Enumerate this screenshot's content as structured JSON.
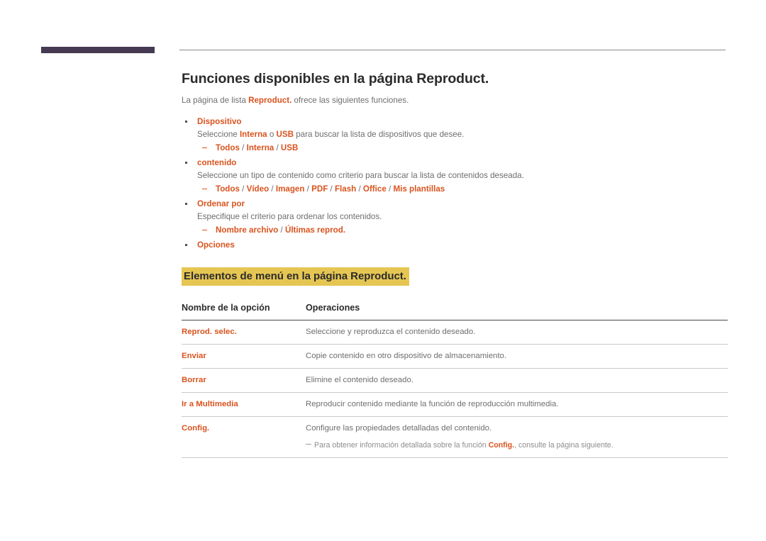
{
  "page": {
    "deco_color": "#453a52",
    "accent_color": "#d9531e",
    "highlight_color": "#e6c653",
    "body_color": "#6e6e6e"
  },
  "title": "Funciones disponibles en la página Reproduct.",
  "intro": {
    "before": "La página de lista ",
    "accent": "Reproduct.",
    "after": " ofrece las siguientes funciones."
  },
  "bullets": [
    {
      "label": "Dispositivo",
      "desc_before": "Seleccione ",
      "desc_accent1": "Interna",
      "desc_mid": " o ",
      "desc_accent2": "USB",
      "desc_after": " para buscar la lista de dispositivos que desee.",
      "options": "Todos / Interna / USB"
    },
    {
      "label": "contenido",
      "desc": "Seleccione un tipo de contenido como criterio para buscar la lista de contenidos deseada.",
      "options": "Todos / Vídeo / Imagen / PDF / Flash / Office / Mis plantillas"
    },
    {
      "label": "Ordenar por",
      "desc": "Especifique el criterio para ordenar los contenidos.",
      "options": "Nombre archivo / Últimas reprod."
    },
    {
      "label": "Opciones"
    }
  ],
  "sub_heading": "Elementos de menú en la página Reproduct.",
  "table": {
    "headers": [
      "Nombre de la opción",
      "Operaciones"
    ],
    "rows": [
      {
        "name": "Reprod. selec.",
        "desc": "Seleccione y reproduzca el contenido deseado."
      },
      {
        "name": "Enviar",
        "desc": "Copie contenido en otro dispositivo de almacenamiento."
      },
      {
        "name": "Borrar",
        "desc": "Elimine el contenido deseado."
      },
      {
        "name": "Ir a Multimedia",
        "desc": "Reproducir contenido mediante la función de reproducción multimedia."
      },
      {
        "name": "Config.",
        "desc": "Configure las propiedades detalladas del contenido.",
        "note_before": "Para obtener información detallada sobre la función ",
        "note_accent": "Config.",
        "note_after": ", consulte la página siguiente."
      }
    ]
  }
}
